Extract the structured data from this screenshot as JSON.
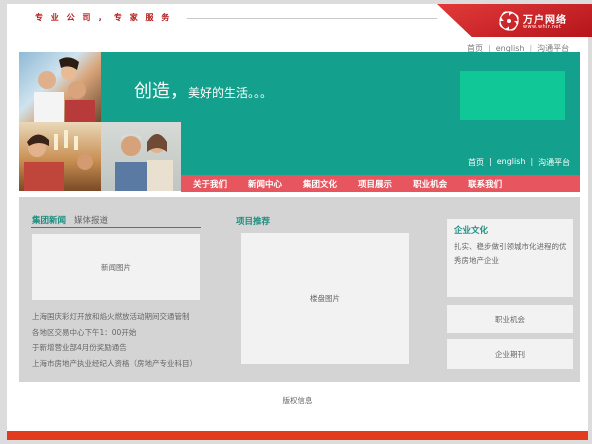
{
  "header": {
    "slogan": "专 业 公 司 ， 专 家 服 务",
    "logo_name": "万户网络",
    "logo_url": "www.whir.net",
    "top_links": [
      "首页",
      "english",
      "沟通平台"
    ]
  },
  "banner": {
    "title_main": "创造，",
    "title_sub": "美好的生活。。。",
    "links": [
      "首页",
      "english",
      "沟通平台"
    ]
  },
  "nav": {
    "items": [
      "关于我们",
      "新闻中心",
      "集团文化",
      "项目展示",
      "职业机会",
      "联系我们"
    ]
  },
  "news": {
    "tabs": [
      "集团新闻",
      "媒体报道"
    ],
    "image_placeholder": "新闻图片",
    "items": [
      "上海国庆彩灯开放和焰火燃放活动期间交通管制",
      "各地区交易中心下午1：00开始",
      "于新增营业部4月份奖励通告",
      "上海市房地产执业经纪人资格（房地产专业科目）"
    ]
  },
  "projects": {
    "title": "项目推荐",
    "image_placeholder": "楼盘图片"
  },
  "sidebar": {
    "culture_title": "企业文化",
    "culture_text": "扎实、稳步做引领城市化进程的优秀房地产企业",
    "buttons": [
      "职业机会",
      "企业期刊"
    ]
  },
  "footer": {
    "copyright": "版权信息"
  },
  "colors": {
    "teal": "#13a08d",
    "nav_red": "#e7565e",
    "brand_red": "#b4151b",
    "bright_green": "#10c797"
  }
}
